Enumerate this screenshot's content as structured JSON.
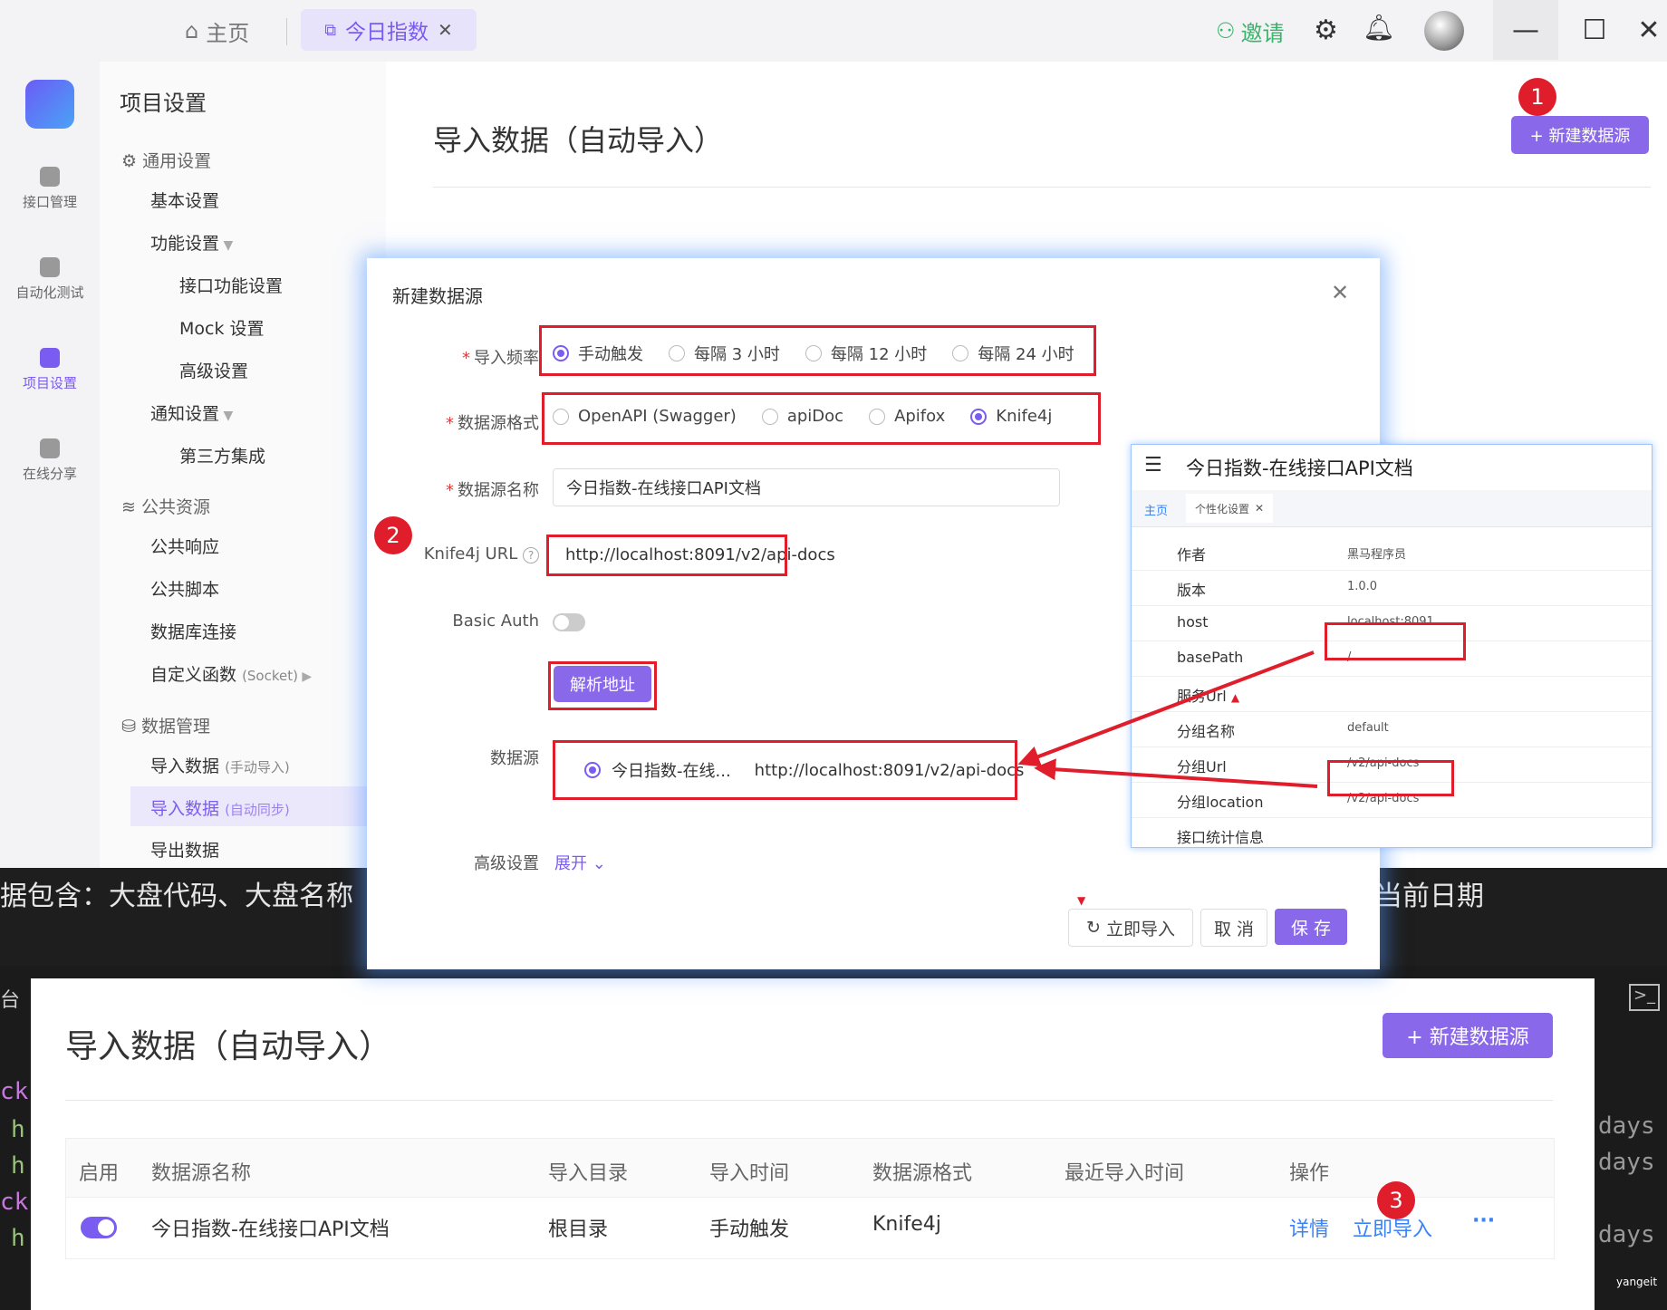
{
  "titlebar": {
    "home_tab": "主页",
    "active_tab": "今日指数",
    "tab_close": "✕",
    "invite": "邀请",
    "minimize": "—",
    "maximize": "☐",
    "close": "✕"
  },
  "leftnav": {
    "items": [
      {
        "label": "接口管理"
      },
      {
        "label": "自动化测试"
      },
      {
        "label": "项目设置"
      },
      {
        "label": "在线分享"
      }
    ]
  },
  "settings": {
    "title": "项目设置",
    "general": "通用设置",
    "basic": "基本设置",
    "feature": "功能设置",
    "api_feature": "接口功能设置",
    "mock": "Mock 设置",
    "advanced": "高级设置",
    "notify": "通知设置",
    "third_party": "第三方集成",
    "public": "公共资源",
    "public_resp": "公共响应",
    "public_script": "公共脚本",
    "db_conn": "数据库连接",
    "custom_func": "自定义函数",
    "custom_func_sub": "(Socket)",
    "data_mgmt": "数据管理",
    "import_manual": "导入数据",
    "import_manual_sub": "(手动导入)",
    "import_auto": "导入数据",
    "import_auto_sub": "(自动同步)",
    "export": "导出数据"
  },
  "main": {
    "title": "导入数据（自动导入）",
    "new_source": "+ 新建数据源"
  },
  "badges": {
    "one": "1",
    "two": "2",
    "three": "3"
  },
  "dialog": {
    "title": "新建数据源",
    "close": "✕",
    "freq_label": "导入频率",
    "freq_options": [
      "手动触发",
      "每隔 3 小时",
      "每隔 12 小时",
      "每隔 24 小时"
    ],
    "format_label": "数据源格式",
    "format_options": [
      "OpenAPI (Swagger)",
      "apiDoc",
      "Apifox",
      "Knife4j"
    ],
    "name_label": "数据源名称",
    "name_value": "今日指数-在线接口API文档",
    "url_label": "Knife4j URL",
    "url_help": "?",
    "url_value": "http://localhost:8091/v2/api-docs",
    "auth_label": "Basic Auth",
    "parse_button": "解析地址",
    "source_label": "数据源",
    "source_name": "今日指数-在线...",
    "source_url": "http://localhost:8091/v2/api-docs",
    "advanced_label": "高级设置",
    "expand": "展开",
    "import_now": "立即导入",
    "cancel": "取 消",
    "save": "保 存"
  },
  "knife4j": {
    "title": "今日指数-在线接口API文档",
    "tab_home": "主页",
    "tab_custom": "个性化设置",
    "rows": [
      {
        "key": "作者",
        "value": "黑马程序员"
      },
      {
        "key": "版本",
        "value": "1.0.0"
      },
      {
        "key": "host",
        "value": "localhost:8091"
      },
      {
        "key": "basePath",
        "value": "/"
      },
      {
        "key": "服务Url",
        "value": ""
      },
      {
        "key": "分组名称",
        "value": "default"
      },
      {
        "key": "分组Url",
        "value": "/v2/api-docs"
      },
      {
        "key": "分组location",
        "value": "/v2/api-docs"
      },
      {
        "key": "接口统计信息",
        "value": ""
      }
    ]
  },
  "darkstrip": {
    "text_left": "据包含：大盘代码、大盘名称",
    "text_right": "当前日期",
    "tai": "台",
    "ck1": "ck",
    "h1": "h",
    "h2": "h",
    "ck2": "ck",
    "h3": "h",
    "days1": "days",
    "days2": "days",
    "days3": "days",
    "watermark": "yangeit"
  },
  "table": {
    "title": "导入数据（自动导入）",
    "new_source": "+ 新建数据源",
    "headers": [
      "启用",
      "数据源名称",
      "导入目录",
      "导入时间",
      "数据源格式",
      "最近导入时间",
      "操作"
    ],
    "row": {
      "name": "今日指数-在线接口API文档",
      "dir": "根目录",
      "time": "手动触发",
      "format": "Knife4j",
      "recent": "",
      "detail": "详情",
      "import_now": "立即导入",
      "more": "···"
    }
  },
  "colors": {
    "accent": "#7b5cf0",
    "red": "#e01d2b",
    "link": "#3b82f6"
  }
}
